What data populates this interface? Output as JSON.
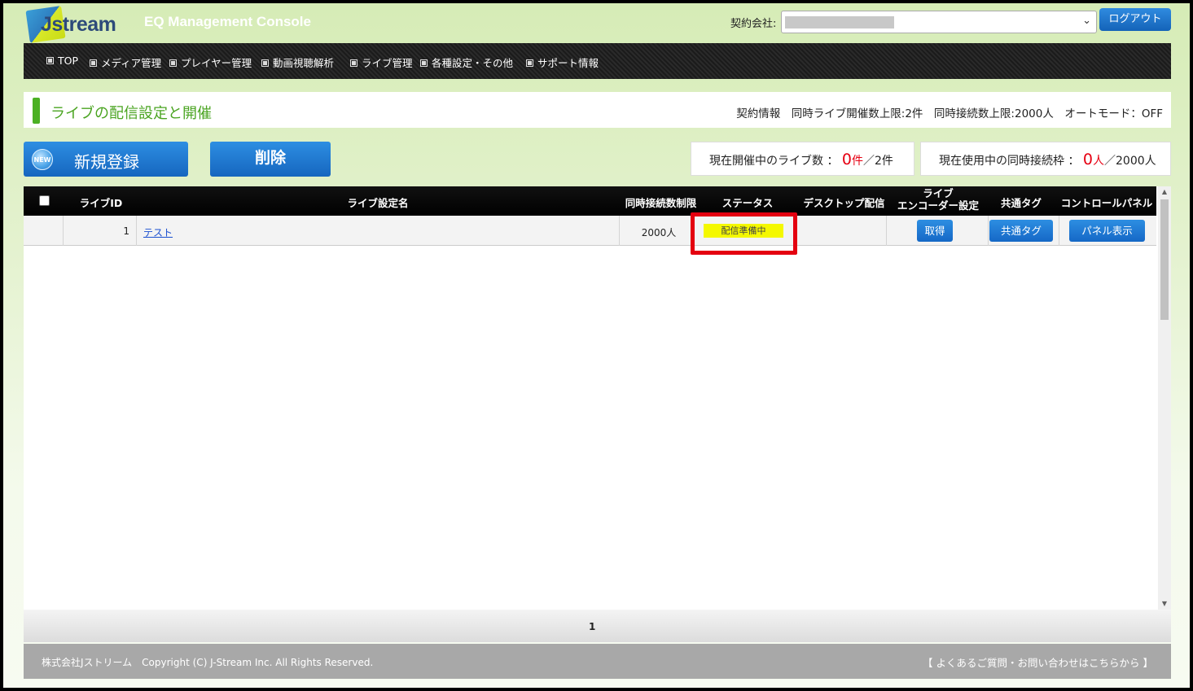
{
  "header": {
    "logo_text": "Jstream",
    "app_title": "EQ Management Console",
    "contract_company_label": "契約会社:",
    "logout_label": "ログアウト"
  },
  "nav": {
    "items": [
      {
        "label": "TOP"
      },
      {
        "label": "メディア管理"
      },
      {
        "label": "プレイヤー管理"
      },
      {
        "label": "動画視聴解析"
      },
      {
        "label": "ライブ管理"
      },
      {
        "label": "各種設定・その他"
      },
      {
        "label": "サポート情報"
      }
    ]
  },
  "page": {
    "title": "ライブの配信設定と開催",
    "contract_info": "契約情報　同時ライブ開催数上限:2件　同時接続数上限:2000人　オートモード：OFF"
  },
  "actions": {
    "new_badge": "NEW",
    "new_label": "新規登録",
    "delete_label": "削除"
  },
  "stats": {
    "live_label": "現在開催中のライブ数 ：",
    "live_current": "0",
    "live_unit": "件",
    "live_limit": "／2件",
    "conn_label": "現在使用中の同時接続枠 ：",
    "conn_current": "0",
    "conn_unit": "人",
    "conn_limit": "／2000人"
  },
  "table": {
    "headers": {
      "live_id": "ライブID",
      "name": "ライブ設定名",
      "limit": "同時接続数制限",
      "status": "ステータス",
      "desktop": "デスクトップ配信",
      "encoder_line1": "ライブ",
      "encoder_line2": "エンコーダー設定",
      "tag": "共通タグ",
      "panel": "コントロールパネル"
    },
    "rows": [
      {
        "live_id": "1",
        "name": "テスト",
        "limit": "2000人",
        "status": "配信準備中",
        "encoder_button": "取得",
        "tag_button": "共通タグ",
        "panel_button": "パネル表示"
      }
    ]
  },
  "pagination": {
    "current_page": "1"
  },
  "footer": {
    "copyright": "株式会社Jストリーム　Copyright (C) J-Stream Inc. All Rights Reserved.",
    "faq_link": "【 よくあるご質問・お問い合わせはこちらから 】"
  },
  "colors": {
    "accent_green": "#4aa421",
    "button_blue": "#1666bf",
    "status_yellow": "#f4f800",
    "highlight_red": "#e40010",
    "count_red": "#e60012"
  }
}
